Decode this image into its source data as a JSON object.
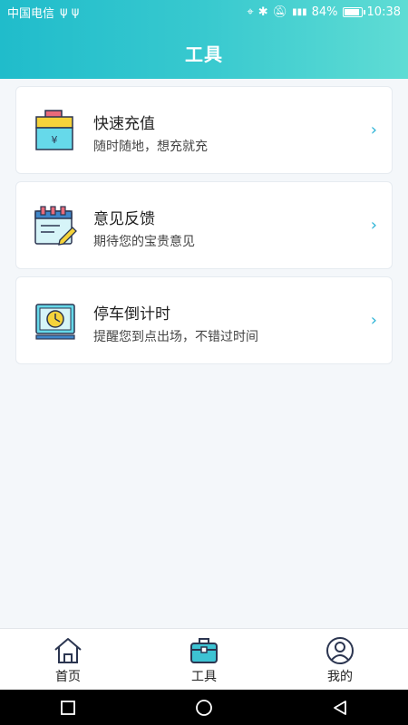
{
  "status_bar": {
    "carrier": "中国电信",
    "battery": "84%",
    "time": "10:38"
  },
  "header": {
    "title": "工具"
  },
  "cards": [
    {
      "title": "快速充值",
      "subtitle": "随时随地，想充就充",
      "icon": "recharge-icon"
    },
    {
      "title": "意见反馈",
      "subtitle": "期待您的宝贵意见",
      "icon": "feedback-icon"
    },
    {
      "title": "停车倒计时",
      "subtitle": "提醒您到点出场，不错过时间",
      "icon": "parking-timer-icon"
    }
  ],
  "chevron": "›",
  "tabs": [
    {
      "label": "首页",
      "icon": "home-icon",
      "active": false
    },
    {
      "label": "工具",
      "icon": "toolbox-icon",
      "active": true
    },
    {
      "label": "我的",
      "icon": "user-icon",
      "active": false
    }
  ],
  "colors": {
    "accent": "#2bb3d6",
    "header_start": "#20bccb",
    "header_end": "#5fdcd4"
  }
}
